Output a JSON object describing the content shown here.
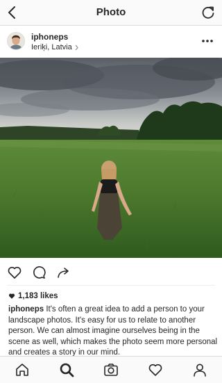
{
  "nav": {
    "title": "Photo",
    "back_icon": "chevron-left-icon",
    "refresh_icon": "refresh-icon"
  },
  "post": {
    "username": "iphoneps",
    "location": "Ieriķi, Latvia",
    "more_icon": "more-dots-icon",
    "likes": "1,183 likes",
    "caption_user": "iphoneps",
    "caption_text": "It's often a great idea to add a person to your landscape photos. It's easy for us to relate to another person. We can almost imagine ourselves being in the scene as well, which makes the photo seem more personal and creates a story in our mind."
  },
  "actions": {
    "icons": [
      "heart-icon",
      "comment-icon",
      "share-icon"
    ]
  },
  "tabbar": {
    "icons": [
      "home-icon",
      "search-icon",
      "camera-icon",
      "heart-icon",
      "profile-icon"
    ]
  },
  "colors": {
    "text": "#262626",
    "border": "#dbdbdb",
    "bar_bg": "#fafafa"
  }
}
